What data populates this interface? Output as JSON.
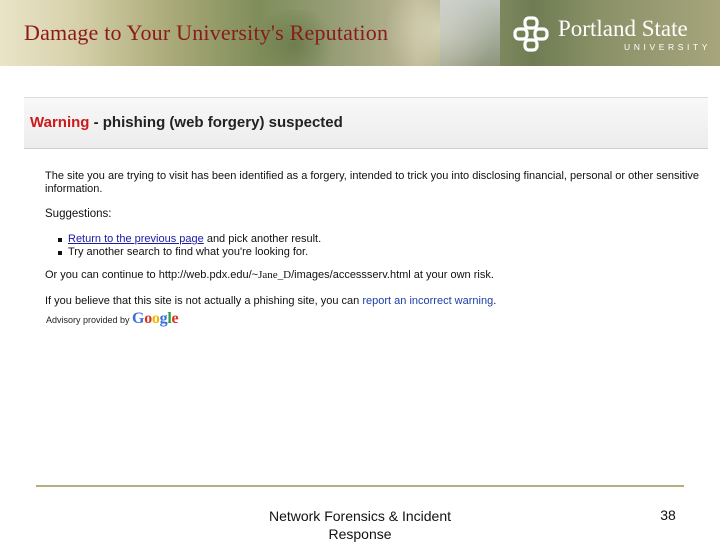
{
  "header": {
    "title": "Damage to Your University's Reputation",
    "logo_name": "Portland State",
    "logo_sub": "UNIVERSITY"
  },
  "warning": {
    "word": "Warning",
    "rest": " - phishing (web forgery) suspected",
    "intro": "The site you are trying to visit has been identified as a forgery, intended to trick you into disclosing financial, personal or other sensitive information.",
    "suggestions_label": "Suggestions:",
    "suggestion_1_link": "Return to the previous page",
    "suggestion_1_rest": " and pick another result.",
    "suggestion_2": "Try another search to find what you're looking for.",
    "continue_prefix": "Or you can continue to ",
    "continue_url_a": "http://web.pdx.edu/~",
    "continue_url_b": "Jane_D",
    "continue_url_c": "/images/accessserv.html",
    "continue_suffix": " at your own risk.",
    "believe_prefix": "If you believe that this site is not actually a phishing site, you can ",
    "report_link": "report an incorrect warning",
    "believe_suffix": ".",
    "advisory_text": "Advisory provided by ",
    "google_letters": [
      "G",
      "o",
      "o",
      "g",
      "l",
      "e"
    ]
  },
  "colors": {
    "title": "#8b1a1a",
    "warning_red": "#cc1a1a",
    "link": "#1a1aa6",
    "google": [
      "#3a6fd8",
      "#d8321f",
      "#f1b600",
      "#3a6fd8",
      "#2e9c3a",
      "#d8321f"
    ]
  },
  "footer": {
    "course": "Network Forensics & Incident Response",
    "page": "38"
  }
}
